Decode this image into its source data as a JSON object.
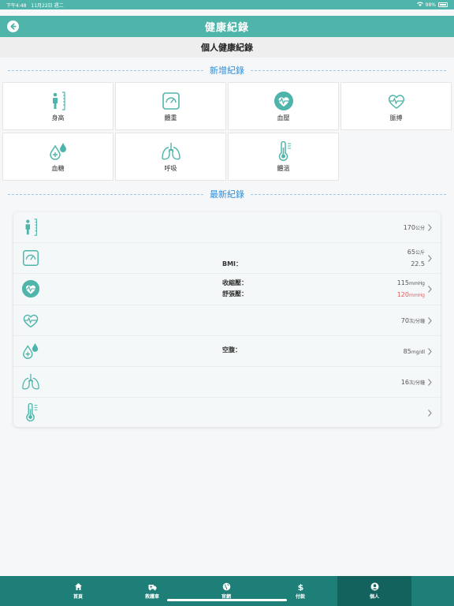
{
  "status_bar": {
    "time": "下午4:48",
    "date": "11月22日 週二",
    "battery": "98%"
  },
  "nav": {
    "title": "健康紀錄"
  },
  "header": {
    "title": "個人健康紀錄"
  },
  "sections": {
    "add": "新增紀錄",
    "latest": "最新紀錄"
  },
  "tiles": [
    {
      "label": "身高",
      "icon": "height-icon"
    },
    {
      "label": "體重",
      "icon": "scale-icon"
    },
    {
      "label": "血壓",
      "icon": "blood-pressure-icon"
    },
    {
      "label": "脈搏",
      "icon": "pulse-icon"
    },
    {
      "label": "血糖",
      "icon": "blood-sugar-icon"
    },
    {
      "label": "呼吸",
      "icon": "lungs-icon"
    },
    {
      "label": "體溫",
      "icon": "thermometer-icon"
    }
  ],
  "records": {
    "height": {
      "value": "170",
      "unit": "公分"
    },
    "weight": {
      "value": "65",
      "unit": "公斤",
      "bmi_label": "BMI：",
      "bmi_value": "22.5"
    },
    "bp": {
      "sys_label": "收縮壓：",
      "sys_value": "115",
      "dia_label": "舒張壓：",
      "dia_value": "120",
      "unit": "mmHg"
    },
    "pulse": {
      "value": "70",
      "unit": "次/分鐘"
    },
    "sugar": {
      "label": "空腹：",
      "value": "85",
      "unit": "mg/dl"
    },
    "breath": {
      "value": "16",
      "unit": "次/分鐘"
    },
    "temp": {}
  },
  "tabs": [
    {
      "label": "首頁",
      "icon": "home-icon"
    },
    {
      "label": "救護車",
      "icon": "ambulance-icon"
    },
    {
      "label": "官網",
      "icon": "globe-icon"
    },
    {
      "label": "付款",
      "icon": "dollar-icon"
    },
    {
      "label": "個人",
      "icon": "person-icon"
    }
  ],
  "colors": {
    "teal": "#4fb5aa",
    "tab_bg": "#1e7f78",
    "alert": "#e65a5a",
    "section": "#2e8fd8"
  }
}
